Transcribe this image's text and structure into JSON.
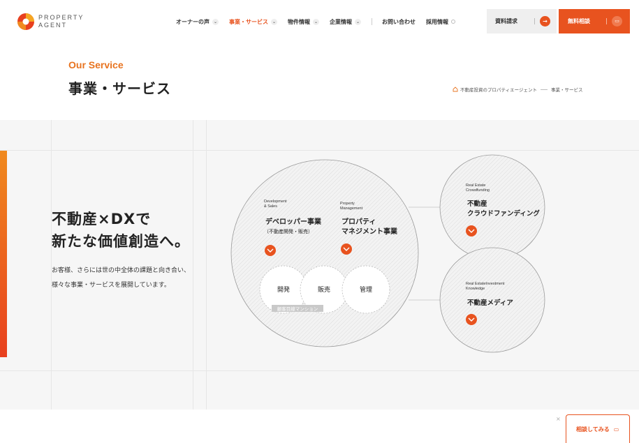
{
  "header": {
    "logo_text_line1": "PROPERTY",
    "logo_text_line2": "AGENT",
    "nav": [
      {
        "label": "オーナーの声",
        "dropdown": true,
        "active": false
      },
      {
        "label": "事業・サービス",
        "dropdown": true,
        "active": true
      },
      {
        "label": "物件情報",
        "dropdown": true,
        "active": false
      },
      {
        "label": "企業情報",
        "dropdown": true,
        "active": false
      }
    ],
    "links": [
      {
        "label": "お問い合わせ"
      },
      {
        "label": "採用情報"
      }
    ],
    "doc_button_label": "資料請求",
    "consult_button_label": "無料相談"
  },
  "page": {
    "eyebrow": "Our Service",
    "title": "事業・サービス",
    "breadcrumb": [
      "不動産投資のプロパティエージェント",
      "事業・サービス"
    ]
  },
  "hero": {
    "headline_line1": "不動産×DXで",
    "headline_line2": "新たな価値創造へ。",
    "desc_line1": "お客様、さらには世の中全体の課題と向き合い、",
    "desc_line2": "様々な事業・サービスを展開しています。"
  },
  "diagram": {
    "main": {
      "dev_en_1": "Development",
      "dev_en_2": "& Sales",
      "dev_jp_1": "デベロッパー事業",
      "dev_jp_2": "（不動産開発・販売）",
      "pm_en_1": "Property",
      "pm_en_2": "Management",
      "pm_jp_1": "プロパティ",
      "pm_jp_2": "マネジメント事業",
      "sub": [
        "開発",
        "販売",
        "管理"
      ],
      "tag": "顧客目線マンション"
    },
    "crowd": {
      "en_1": "Real Estate",
      "en_2": "Crowdfunding",
      "jp_1": "不動産",
      "jp_2": "クラウドファンディング"
    },
    "media": {
      "en_1": "Real EstateInvestment",
      "en_2": "Knowledge",
      "jp_1": "不動産メディア"
    }
  },
  "floating": {
    "close": "×",
    "consult_label": "相談してみる"
  },
  "colors": {
    "accent": "#e8531f",
    "accent_orange": "#e8731f",
    "section_bg": "#f6f6f6"
  }
}
